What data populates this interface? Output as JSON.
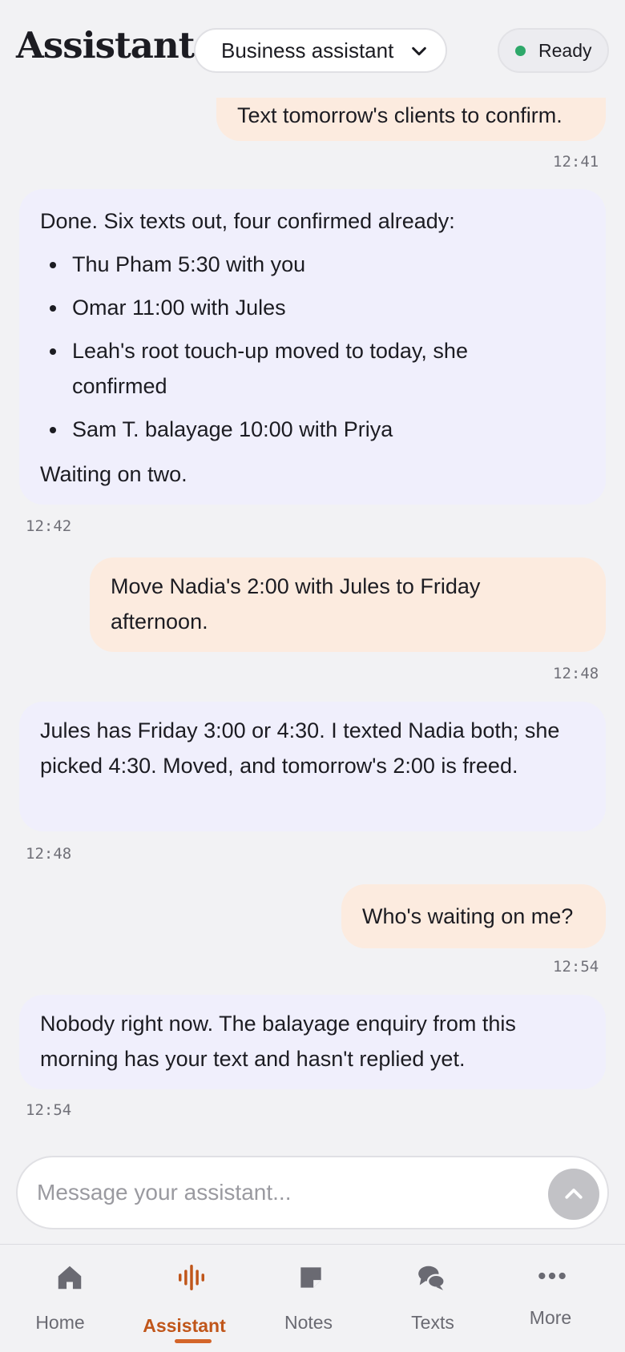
{
  "header": {
    "title": "Assistant",
    "mode_selected": "Business assistant",
    "status": "Ready",
    "status_color": "#2ea86a"
  },
  "messages": [
    {
      "role": "user",
      "text": "Text tomorrow's clients to confirm.",
      "time": "12:41"
    },
    {
      "role": "assistant",
      "intro": "Done. Six texts out, four confirmed already:",
      "items": [
        "Thu Pham 5:30 with you",
        "Omar 11:00 with Jules",
        "Leah's root touch-up moved to today, she confirmed",
        "Sam T. balayage 10:00 with Priya"
      ],
      "outro": "Waiting on two.",
      "time": "12:42"
    },
    {
      "role": "user",
      "text": "Move Nadia's 2:00 with Jules to Friday afternoon.",
      "time": "12:48"
    },
    {
      "role": "assistant",
      "text": "Jules has Friday 3:00 or 4:30. I texted Nadia both; she picked 4:30. Moved, and tomorrow's 2:00 is freed.",
      "time": "12:48"
    },
    {
      "role": "user",
      "text": "Who's waiting on me?",
      "time": "12:54"
    },
    {
      "role": "assistant",
      "text": "Nobody right now. The balayage enquiry from this morning has your text and hasn't replied yet.",
      "time": "12:54"
    }
  ],
  "composer": {
    "placeholder": "Message your assistant...",
    "value": ""
  },
  "tabs": [
    {
      "label": "Home",
      "icon": "home-icon"
    },
    {
      "label": "Assistant",
      "icon": "waveform-icon",
      "active": true
    },
    {
      "label": "Notes",
      "icon": "note-icon"
    },
    {
      "label": "Texts",
      "icon": "chat-bubbles-icon"
    },
    {
      "label": "More",
      "icon": "more-dots-icon"
    }
  ],
  "colors": {
    "accent": "#c0561a",
    "user_bubble": "#fcebdf",
    "assistant_bubble": "#f0effc",
    "background": "#f2f2f4"
  }
}
